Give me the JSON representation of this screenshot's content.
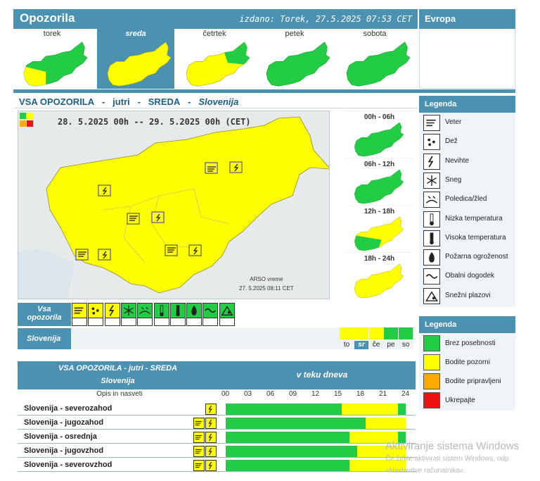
{
  "header": {
    "title": "Opozorila",
    "issued": "izdano: Torek, 27.5.2025 07:53 CET",
    "europe": "Evropa"
  },
  "days": [
    {
      "label": "torek",
      "selected": false
    },
    {
      "label": "sreda",
      "selected": true
    },
    {
      "label": "četrtek",
      "selected": false
    },
    {
      "label": "petek",
      "selected": false
    },
    {
      "label": "sobota",
      "selected": false
    }
  ],
  "section": {
    "p1": "VSA OPOZORILA",
    "sep1": "-",
    "p2": "jutri",
    "sep2": "-",
    "p3": "SREDA",
    "sep3": "-",
    "p4": "Slovenija"
  },
  "map": {
    "period": "28. 5.2025 00h -- 29. 5.2025 00h    (CET)",
    "source": "ARSO vreme",
    "source_time": "27. 5.2025  08:11 CET"
  },
  "slots": [
    {
      "label": "00h - 06h"
    },
    {
      "label": "06h - 12h"
    },
    {
      "label": "12h - 18h"
    },
    {
      "label": "18h - 24h"
    }
  ],
  "legend": {
    "title": "Legenda",
    "items": [
      {
        "label": "Veter",
        "icon": "wind-icon"
      },
      {
        "label": "Dež",
        "icon": "rain-icon"
      },
      {
        "label": "Nevihte",
        "icon": "thunderstorm-icon"
      },
      {
        "label": "Sneg",
        "icon": "snow-icon"
      },
      {
        "label": "Poledica/žled",
        "icon": "ice-icon"
      },
      {
        "label": "Nizka temperatura",
        "icon": "low-temperature-icon"
      },
      {
        "label": "Visoka temperatura",
        "icon": "high-temperature-icon"
      },
      {
        "label": "Požarna ogroženost",
        "icon": "fire-icon"
      },
      {
        "label": "Obalni dogodek",
        "icon": "coastal-icon"
      },
      {
        "label": "Snežni plazovi",
        "icon": "avalanche-icon"
      }
    ]
  },
  "levels": {
    "title": "Legenda",
    "items": [
      {
        "label": "Brez posebnosti",
        "color": "#22cc44"
      },
      {
        "label": "Bodite pozorni",
        "color": "#ffff00"
      },
      {
        "label": "Bodite pripravljeni",
        "color": "#ffaa00"
      },
      {
        "label": "Ukrepajte",
        "color": "#ee1111"
      }
    ]
  },
  "all_warnings": {
    "label_l1": "Vsa",
    "label_l2": "opozorila"
  },
  "slovenia": {
    "label": "Slovenija",
    "days": [
      {
        "label": "to",
        "selected": false,
        "color": "#ffff00"
      },
      {
        "label": "sr",
        "selected": true,
        "color": "#ffff00"
      },
      {
        "label": "če",
        "selected": false,
        "color": "#ffff00"
      },
      {
        "label": "pe",
        "selected": false,
        "color": "#22cc44"
      },
      {
        "label": "so",
        "selected": false,
        "color": "#22cc44"
      }
    ]
  },
  "table": {
    "title": "VSA OPOZORILA - jutri - SREDA",
    "subtitle": "Slovenija",
    "timeline_title": "v teku dneva",
    "col_desc": "Opis in nasveti",
    "hours": [
      "00",
      "03",
      "06",
      "09",
      "12",
      "15",
      "18",
      "21",
      "24"
    ],
    "rows": [
      {
        "name": "Slovenija - severozahod",
        "icons": [
          "thunderstorm-icon"
        ],
        "yellow_from": 15.5,
        "yellow_to": 23.0
      },
      {
        "name": "Slovenija - jugozahod",
        "icons": [
          "wind-icon",
          "thunderstorm-icon"
        ],
        "yellow_from": 18.7,
        "yellow_to": 24
      },
      {
        "name": "Slovenija - osrednja",
        "icons": [
          "wind-icon",
          "thunderstorm-icon"
        ],
        "yellow_from": 16.5,
        "yellow_to": 23.0
      },
      {
        "name": "Slovenija - jugovzhod",
        "icons": [
          "wind-icon",
          "thunderstorm-icon"
        ],
        "yellow_from": 17.5,
        "yellow_to": 24
      },
      {
        "name": "Slovenija - severovzhod",
        "icons": [
          "wind-icon",
          "thunderstorm-icon"
        ],
        "yellow_from": 16.5,
        "yellow_to": 24
      }
    ]
  },
  "watermark": {
    "line1": "Aktiviranje sistema Windows",
    "line2": "Če želite aktivirati sistem Windows, odp",
    "line3": "»Nastavitve računalnika«."
  }
}
